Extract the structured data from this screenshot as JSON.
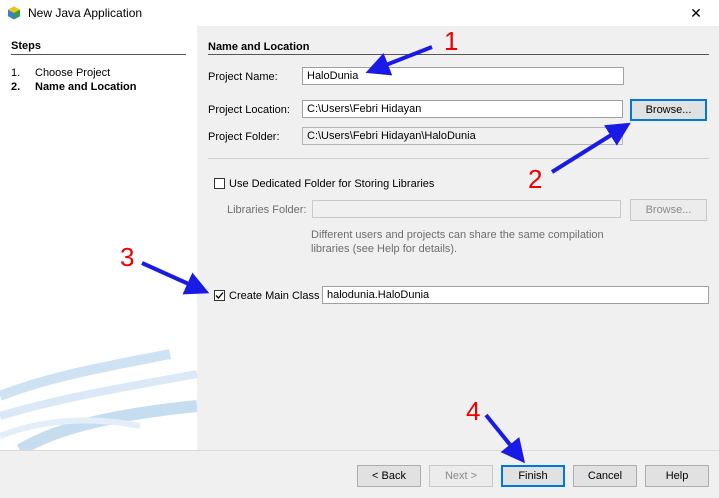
{
  "window": {
    "title": "New Java Application",
    "close_glyph": "✕"
  },
  "steps": {
    "heading": "Steps",
    "items": [
      {
        "number": "1.",
        "label": "Choose Project",
        "current": false
      },
      {
        "number": "2.",
        "label": "Name and Location",
        "current": true
      }
    ]
  },
  "form": {
    "heading": "Name and Location",
    "project_name": {
      "label": "Project Name:",
      "value": "HaloDunia"
    },
    "project_location": {
      "label": "Project Location:",
      "value": "C:\\Users\\Febri Hidayan",
      "browse": "Browse..."
    },
    "project_folder": {
      "label": "Project Folder:",
      "value": "C:\\Users\\Febri Hidayan\\HaloDunia"
    },
    "dedicated_folder": {
      "label": "Use Dedicated Folder for Storing Libraries",
      "checked": false
    },
    "libraries_folder": {
      "label": "Libraries Folder:",
      "value": "",
      "browse": "Browse..."
    },
    "libraries_hint": {
      "line1": "Different users and projects can share the same compilation",
      "line2": "libraries (see Help for details)."
    },
    "main_class": {
      "label": "Create Main Class",
      "checked": true,
      "value": "halodunia.HaloDunia"
    }
  },
  "buttons": {
    "back": "< Back",
    "next": "Next >",
    "finish": "Finish",
    "cancel": "Cancel",
    "help": "Help"
  },
  "annotations": [
    "1",
    "2",
    "3",
    "4"
  ],
  "colors": {
    "arrow": "#1a1ae6",
    "annotation_number": "#ee0000",
    "focus": "#0078d7"
  }
}
